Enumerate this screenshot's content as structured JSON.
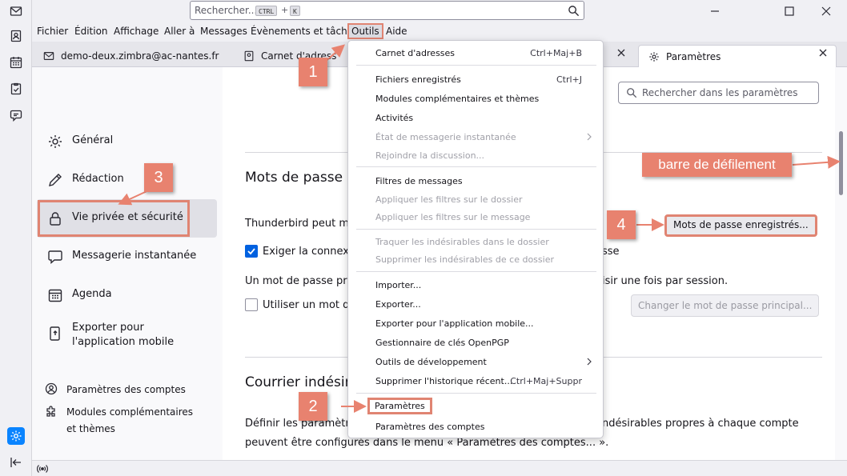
{
  "titlebar": {
    "search_placeholder": "Rechercher...",
    "kbd_ctrl": "CTRL",
    "kbd_plus": "+",
    "kbd_k": "K"
  },
  "menubar": [
    "Fichier",
    "Édition",
    "Affichage",
    "Aller à",
    "Messages",
    "Évènements et tâches",
    "Outils",
    "Aide"
  ],
  "tabs": [
    {
      "label": "demo-deux.zimbra@ac-nantes.fr"
    },
    {
      "label": "Carnet d'adresses"
    },
    {
      "label": "Paramètres"
    }
  ],
  "sidebar": {
    "items": [
      {
        "label": "Général"
      },
      {
        "label": "Rédaction"
      },
      {
        "label": "Vie privée et sécurité"
      },
      {
        "label": "Messagerie instantanée"
      },
      {
        "label": "Agenda"
      },
      {
        "label": "Exporter pour l'application mobile"
      }
    ],
    "bottom": [
      {
        "label": "Paramètres des comptes"
      },
      {
        "label": "Modules complémentaires et thèmes"
      }
    ]
  },
  "settings": {
    "search_placeholder": "Rechercher dans les paramètres",
    "passwords_heading": "Mots de passe",
    "passwords_text_a": "Thunderbird peut mém",
    "saved_passwords_button": "Mots de passe enregistrés...",
    "require_connection_a": "Exiger la connexio",
    "require_connection_b": "sse",
    "primary_pw_text_a": "Un mot de passe prin",
    "primary_pw_text_b": "isir une fois par session.",
    "use_primary_pw_a": "Utiliser un mot de",
    "change_primary_pw_button": "Changer le mot de passe principal...",
    "junk_heading": "Courrier indésira",
    "junk_text_1a": "Définir les paramètres",
    "junk_text_1b": "ndésirables propres à chaque compte",
    "junk_text_2": "peuvent être configurés dans le menu « Paramètres des comptes... »."
  },
  "outils_menu": [
    {
      "label": "Carnet d'adresses",
      "shortcut": "Ctrl+Maj+B",
      "disabled": false
    },
    {
      "label": "Fichiers enregistrés",
      "shortcut": "Ctrl+J",
      "disabled": false
    },
    {
      "label": "Modules complémentaires et thèmes",
      "shortcut": "",
      "disabled": false
    },
    {
      "label": "Activités",
      "shortcut": "",
      "disabled": false
    },
    {
      "label": "État de messagerie instantanée",
      "shortcut": "",
      "disabled": true,
      "submenu": true
    },
    {
      "label": "Rejoindre la discussion...",
      "shortcut": "",
      "disabled": true
    },
    {
      "label": "Filtres de messages",
      "shortcut": "",
      "disabled": false
    },
    {
      "label": "Appliquer les filtres sur le dossier",
      "shortcut": "",
      "disabled": true
    },
    {
      "label": "Appliquer les filtres sur le message",
      "shortcut": "",
      "disabled": true
    },
    {
      "label": "Traquer les indésirables dans le dossier",
      "shortcut": "",
      "disabled": true
    },
    {
      "label": "Supprimer les indésirables de ce dossier",
      "shortcut": "",
      "disabled": true
    },
    {
      "label": "Importer...",
      "shortcut": "",
      "disabled": false
    },
    {
      "label": "Exporter...",
      "shortcut": "",
      "disabled": false
    },
    {
      "label": "Exporter pour l'application mobile...",
      "shortcut": "",
      "disabled": false
    },
    {
      "label": "Gestionnaire de clés OpenPGP",
      "shortcut": "",
      "disabled": false
    },
    {
      "label": "Outils de développement",
      "shortcut": "",
      "disabled": false,
      "submenu": true
    },
    {
      "label": "Supprimer l'historique récent...",
      "shortcut": "Ctrl+Maj+Suppr",
      "disabled": false
    },
    {
      "label": "Paramètres",
      "shortcut": "",
      "disabled": false
    },
    {
      "label": "Paramètres des comptes",
      "shortcut": "",
      "disabled": false
    }
  ],
  "annotations": {
    "badge1": "1",
    "badge2": "2",
    "badge3": "3",
    "badge4": "4",
    "callout": "barre de défilement"
  },
  "colors": {
    "annotation": "#e8826f",
    "accent": "#0a84ff",
    "checkbox": "#0061e0"
  }
}
